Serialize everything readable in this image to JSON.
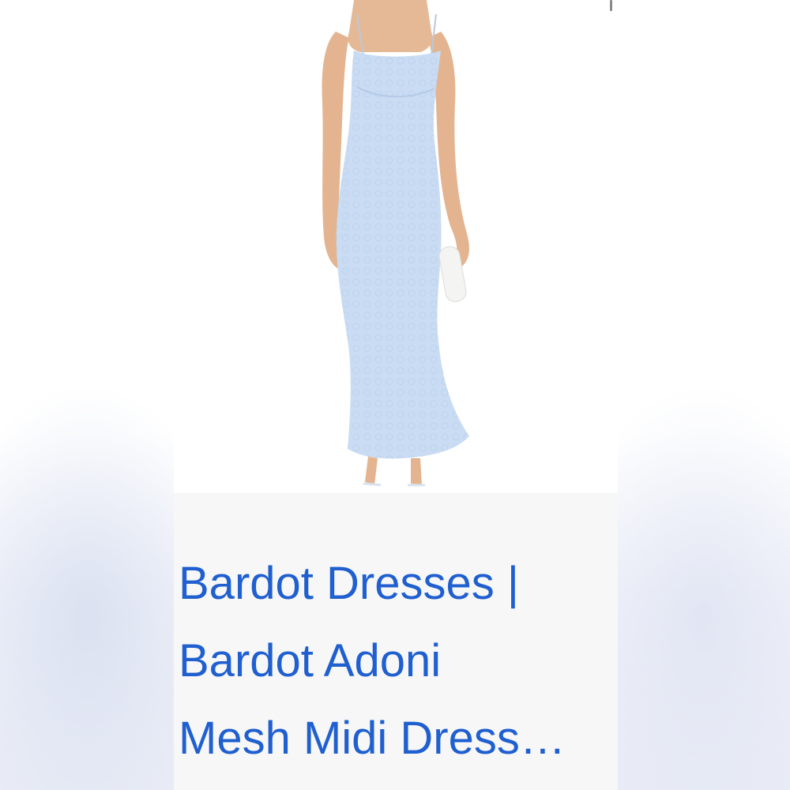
{
  "product": {
    "image_alt": "Light blue mesh midi slip dress on model",
    "colors": {
      "dress": "#c9dcf3",
      "link": "#1f5fcf",
      "caption_bg": "#f7f7f8"
    },
    "title_lines": [
      "Bardot Dresses |",
      "Bardot Adoni",
      "Mesh Midi Dress…"
    ]
  }
}
